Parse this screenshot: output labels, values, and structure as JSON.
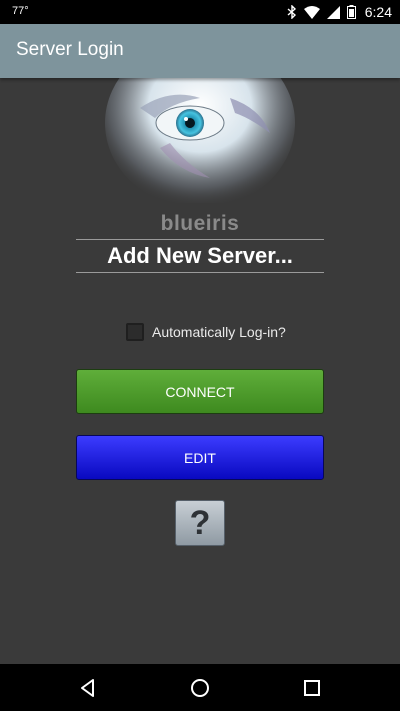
{
  "status_bar": {
    "temperature": "77°",
    "time": "6:24",
    "icons": [
      "bluetooth-icon",
      "wifi-icon",
      "signal-icon",
      "battery-icon"
    ]
  },
  "app_bar": {
    "title": "Server Login"
  },
  "logo": {
    "brand": "blueiris"
  },
  "server_select": {
    "value": "Add New Server..."
  },
  "auto_login": {
    "label": "Automatically Log-in?",
    "checked": false
  },
  "buttons": {
    "connect": "CONNECT",
    "edit": "EDIT",
    "help": "?"
  },
  "colors": {
    "app_bar": "#7e949c",
    "connect": "#4a9b2a",
    "edit": "#1a1ae6",
    "background": "#3a3a3a"
  },
  "nav_bar": {
    "icons": [
      "back-icon",
      "home-icon",
      "recents-icon"
    ]
  }
}
